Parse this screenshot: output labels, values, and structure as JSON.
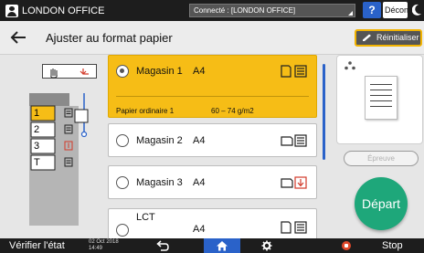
{
  "topbar": {
    "user_name": "LONDON OFFICE",
    "connection_status": "Connecté : [LONDON OFFICE]",
    "help_label": "?",
    "logout_label": "Déconnexion"
  },
  "header": {
    "title": "Ajuster au format papier",
    "reset_label": "Réinitialiser"
  },
  "printer_trays": [
    "1",
    "2",
    "3",
    "T"
  ],
  "trays": [
    {
      "name": "Magasin 1",
      "size": "A4",
      "selected": true,
      "paper_type": "Papier ordinaire 1",
      "paper_weight": "60 – 74 g/m2"
    },
    {
      "name": "Magasin 2",
      "size": "A4",
      "selected": false
    },
    {
      "name": "Magasin 3",
      "size": "A4",
      "selected": false
    },
    {
      "name": "LCT",
      "size": "A4",
      "selected": false
    }
  ],
  "right_panel": {
    "proof_label": "Épreuve",
    "start_label": "Départ"
  },
  "bottombar": {
    "check_status_label": "Vérifier l'état",
    "date": "02 Oct 2018",
    "time": "14:49",
    "stop_label": "Stop"
  },
  "colors": {
    "accent_yellow": "#f6bd16",
    "accent_blue": "#2a62c9",
    "start_green": "#1ea77a",
    "stop_red": "#e0482a"
  }
}
